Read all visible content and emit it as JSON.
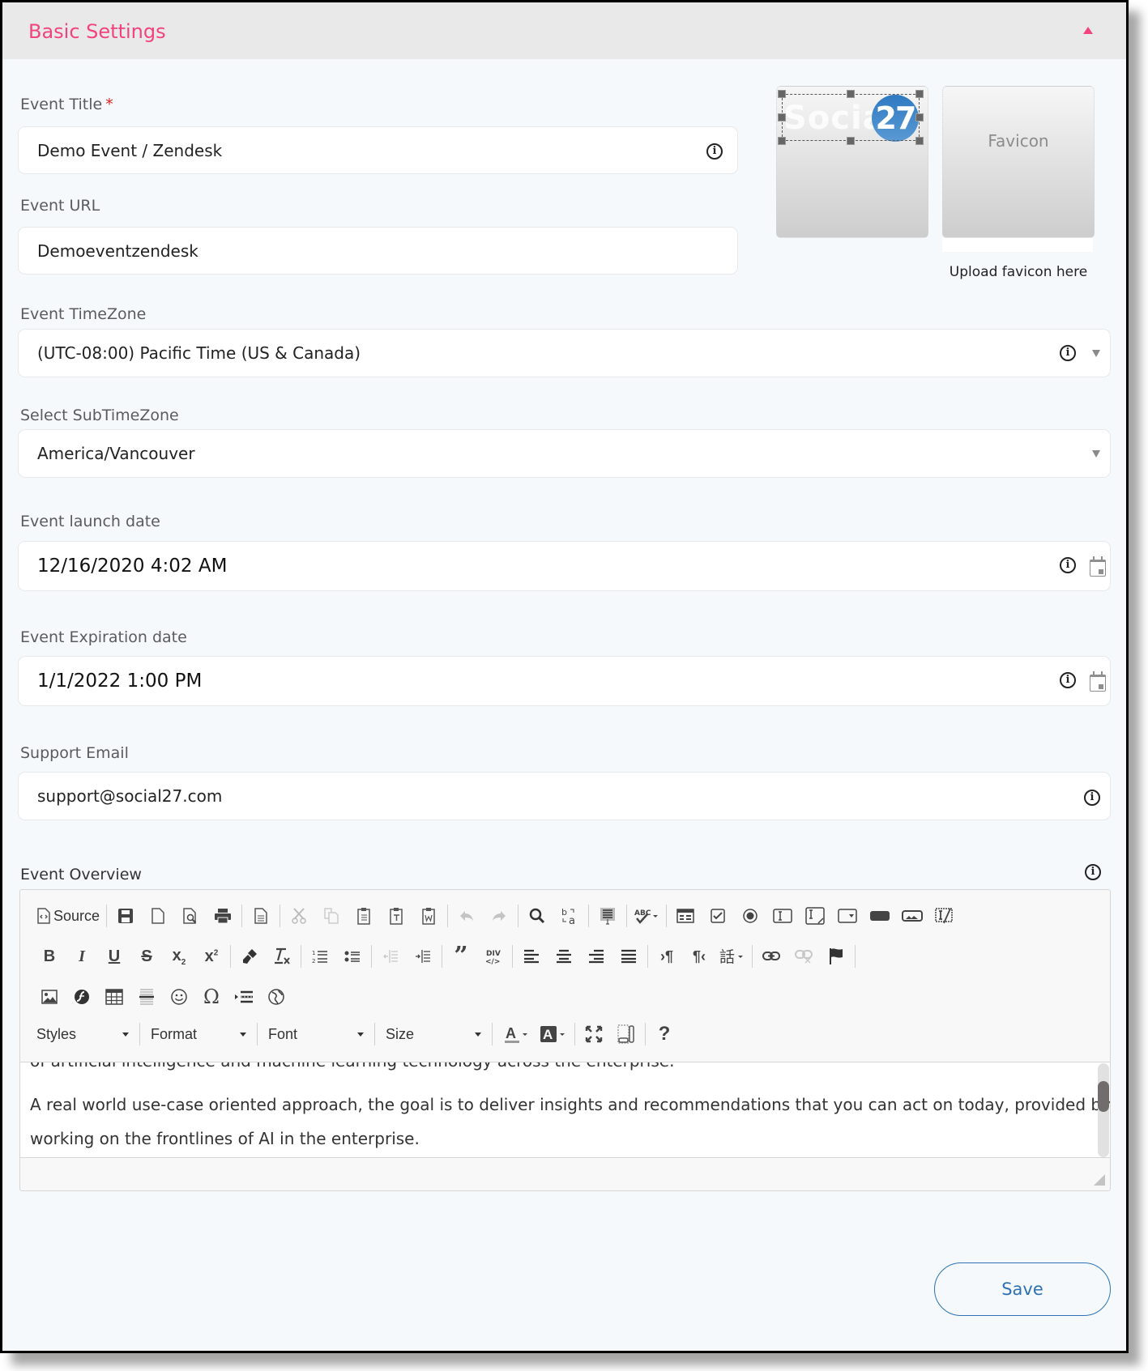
{
  "section": {
    "title": "Basic Settings",
    "collapse_icon": "caret-up-icon",
    "accent_color": "#f2437d"
  },
  "fields": {
    "event_title": {
      "label": "Event Title",
      "required_mark": "*",
      "value": "Demo Event / Zendesk"
    },
    "event_url": {
      "label": "Event URL",
      "value": "Demoeventzendesk"
    },
    "timezone": {
      "label": "Event TimeZone",
      "value": "(UTC-08:00) Pacific Time (US & Canada)"
    },
    "sub_timezone": {
      "label": "Select SubTimeZone",
      "value": "America/Vancouver"
    },
    "launch_date": {
      "label": "Event launch date",
      "value": "12/16/2020 4:02 AM"
    },
    "expiration_date": {
      "label": "Event Expiration date",
      "value": "1/1/2022 1:00 PM"
    },
    "support_email": {
      "label": "Support Email",
      "value": "support@social27.com"
    }
  },
  "logo": {
    "text": "Social",
    "badge": "27",
    "badge_color": "#2f79c2"
  },
  "favicon": {
    "placeholder": "Favicon",
    "caption": "Upload favicon here"
  },
  "overview": {
    "label": "Event Overview",
    "toolbar": {
      "source_label": "Source",
      "combos": [
        "Styles",
        "Format",
        "Font",
        "Size"
      ]
    },
    "content_lines": [
      "of artificial intelligence and machine learning technology across the enterprise.",
      "A real world use-case oriented approach, the goal is to deliver insights and recommendations that you can act on today, provided by those",
      "working on the frontlines of AI in the enterprise."
    ]
  },
  "actions": {
    "save_label": "Save",
    "save_color": "#2e72b5"
  }
}
